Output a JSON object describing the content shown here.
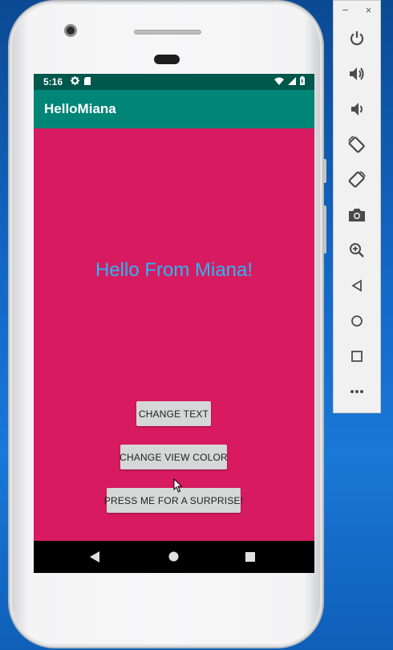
{
  "status_bar": {
    "time": "5:16",
    "settings_icon": "gear-icon",
    "sd_icon": "sd-card-icon",
    "wifi_icon": "wifi-icon",
    "signal_icon": "signal-icon",
    "battery_icon": "battery-icon"
  },
  "app_bar": {
    "title": "HelloMiana"
  },
  "content": {
    "message": "Hello From Miana!"
  },
  "buttons": {
    "change_text": "CHANGE TEXT",
    "change_color": "CHANGE VIEW COLOR",
    "surprise": "PRESS ME FOR A SURPRISE!"
  },
  "nav_bar": [
    "back-icon",
    "home-icon",
    "recents-icon"
  ],
  "emulator_panel": {
    "window_controls": [
      "−",
      "×"
    ],
    "tools": [
      "power-icon",
      "volume-up-icon",
      "volume-down-icon",
      "rotate-left-icon",
      "rotate-right-icon",
      "camera-icon",
      "zoom-icon",
      "back-icon",
      "home-icon",
      "overview-icon",
      "more-icon"
    ]
  },
  "colors": {
    "screen_bg": "#d81b60",
    "app_bar": "#008577",
    "status_bar": "#00574b",
    "message_text": "#29b6f6",
    "button_bg": "#d6d7d7"
  }
}
